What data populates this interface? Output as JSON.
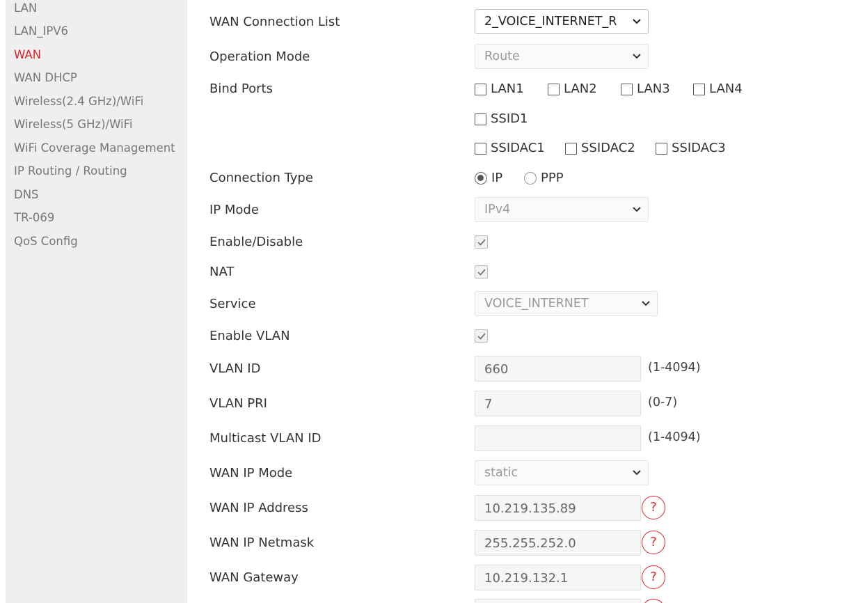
{
  "sidebar": {
    "items": [
      {
        "label": "LAN",
        "active": false
      },
      {
        "label": "LAN_IPV6",
        "active": false
      },
      {
        "label": "WAN",
        "active": true
      },
      {
        "label": "WAN DHCP",
        "active": false
      },
      {
        "label": "Wireless(2.4 GHz)/WiFi",
        "active": false
      },
      {
        "label": "Wireless(5 GHz)/WiFi",
        "active": false
      },
      {
        "label": "WiFi Coverage Management",
        "active": false
      },
      {
        "label": "IP Routing / Routing",
        "active": false
      },
      {
        "label": "DNS",
        "active": false
      },
      {
        "label": "TR-069",
        "active": false
      },
      {
        "label": "QoS Config",
        "active": false
      }
    ],
    "active_color": "#d8262b"
  },
  "form": {
    "wan_connection_list": {
      "label": "WAN Connection List",
      "value": "2_VOICE_INTERNET_R"
    },
    "operation_mode": {
      "label": "Operation Mode",
      "value": "Route"
    },
    "bind_ports": {
      "label": "Bind Ports",
      "ports": [
        "LAN1",
        "LAN2",
        "LAN3",
        "LAN4"
      ],
      "ssid": [
        "SSID1"
      ],
      "ssidac": [
        "SSIDAC1",
        "SSIDAC2",
        "SSIDAC3"
      ]
    },
    "connection_type": {
      "label": "Connection Type",
      "options": [
        "IP",
        "PPP"
      ],
      "selected": "IP"
    },
    "ip_mode": {
      "label": "IP Mode",
      "value": "IPv4"
    },
    "enable_disable": {
      "label": "Enable/Disable",
      "checked": true
    },
    "nat": {
      "label": "NAT",
      "checked": true
    },
    "service": {
      "label": "Service",
      "value": "VOICE_INTERNET"
    },
    "enable_vlan": {
      "label": "Enable VLAN",
      "checked": true
    },
    "vlan_id": {
      "label": "VLAN ID",
      "value": "660",
      "hint": "(1-4094)"
    },
    "vlan_pri": {
      "label": "VLAN PRI",
      "value": "7",
      "hint": "(0-7)"
    },
    "multicast_vlan_id": {
      "label": "Multicast VLAN ID",
      "value": "",
      "hint": "(1-4094)"
    },
    "wan_ip_mode": {
      "label": "WAN IP Mode",
      "value": "static"
    },
    "wan_ip_address": {
      "label": "WAN IP Address",
      "value": "10.219.135.89",
      "help": "?"
    },
    "wan_ip_netmask": {
      "label": "WAN IP Netmask",
      "value": "255.255.252.0",
      "help": "?"
    },
    "wan_gateway": {
      "label": "WAN Gateway",
      "value": "10.219.132.1",
      "help": "?"
    }
  }
}
